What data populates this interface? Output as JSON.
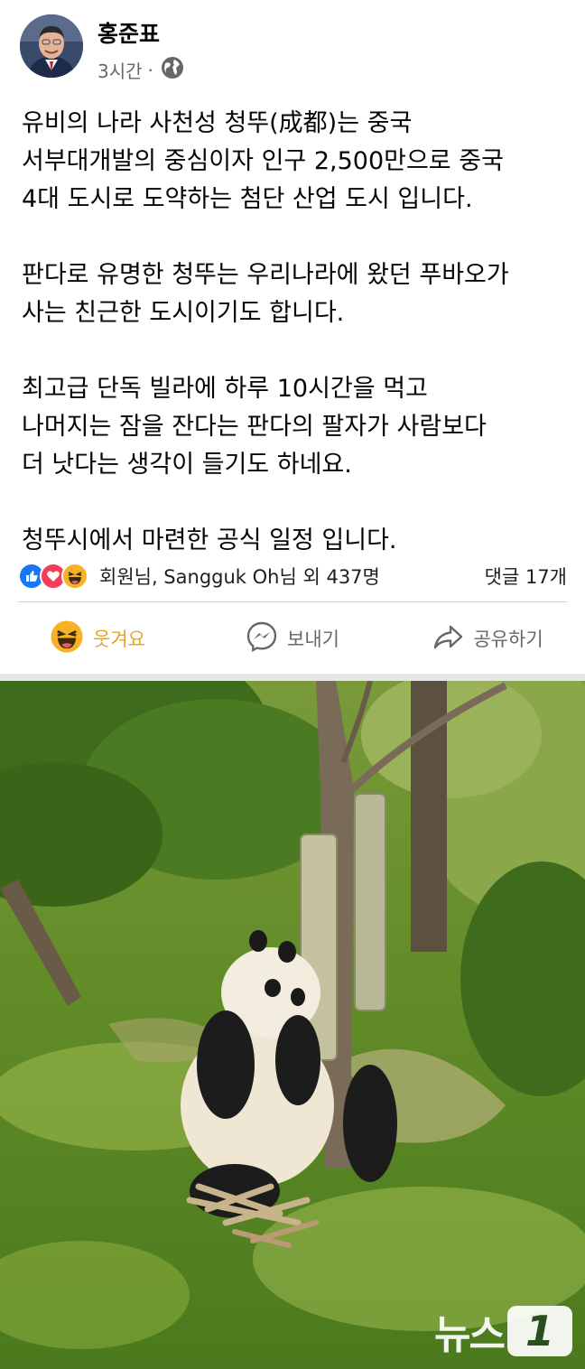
{
  "post": {
    "author": "홍준표",
    "time": "3시간",
    "separator": "·",
    "privacy_icon": "globe-icon",
    "lines": [
      "유비의 나라 사천성 청뚜(成都)는 중국",
      "서부대개발의 중심이자 인구 2,500만으로 중국",
      "4대 도시로 도약하는 첨단 산업 도시 입니다.",
      "",
      "판다로 유명한 청뚜는 우리나라에 왔던 푸바오가",
      "사는 친근한 도시이기도 합니다.",
      "",
      "최고급 단독 빌라에 하루 10시간을 먹고",
      "나머지는 잠을 잔다는 판다의 팔자가 사람보다",
      "더 낫다는 생각이 들기도 하네요.",
      "",
      "청뚜시에서 마련한 공식 일정 입니다."
    ]
  },
  "reactions": {
    "icons": [
      "like-reaction-icon",
      "love-reaction-icon",
      "haha-reaction-icon"
    ],
    "summary": "회원님, Sangguk Oh님 외 437명",
    "comments": "댓글 17개"
  },
  "actions": {
    "react_label": "웃겨요",
    "send_label": "보내기",
    "share_label": "공유하기"
  },
  "watermark": {
    "text": "뉴스",
    "badge": "1"
  },
  "colors": {
    "like_blue": "#1877f2",
    "love_red": "#f33e58",
    "haha_yellow": "#f7b125",
    "active_reaction": "#e8a42b",
    "secondary_text": "#65676b"
  }
}
